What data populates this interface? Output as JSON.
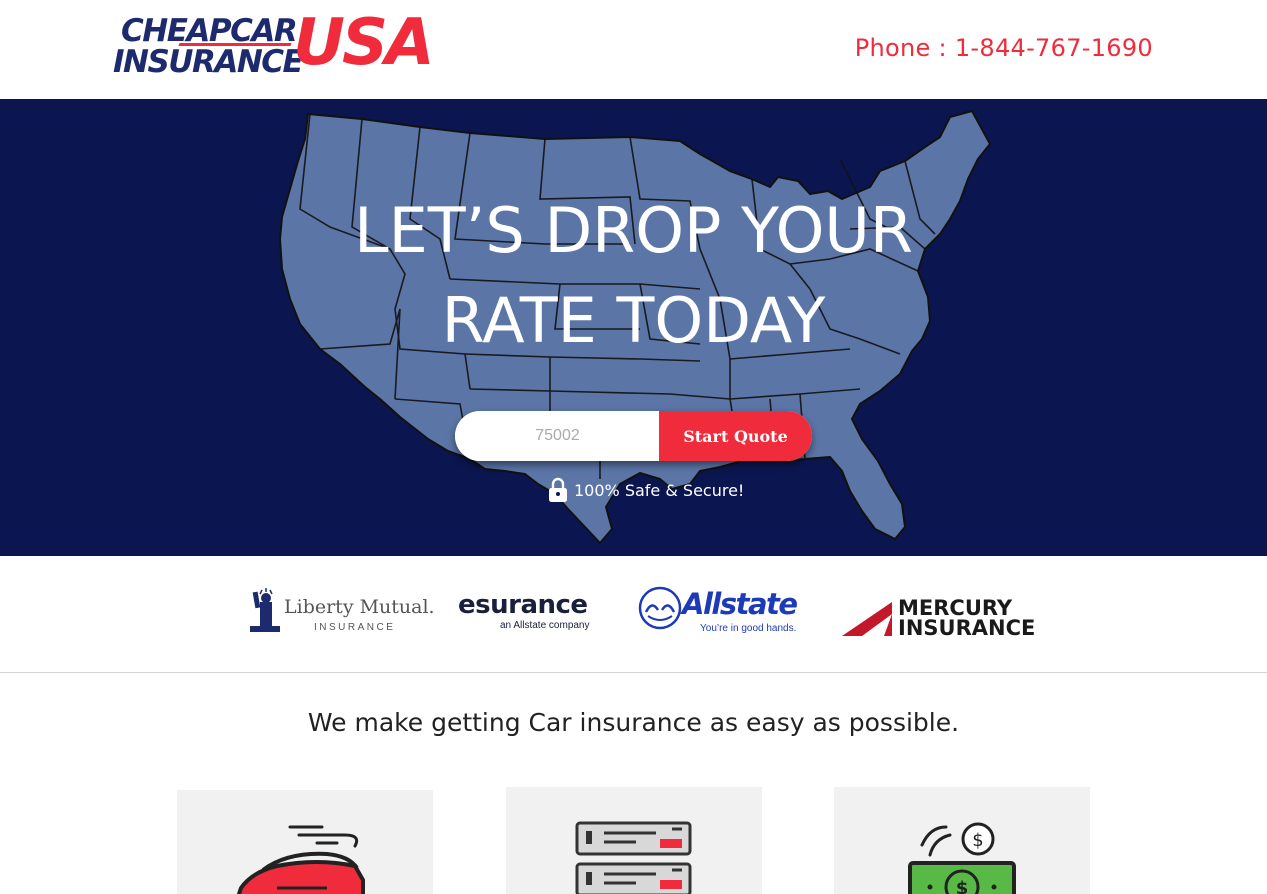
{
  "header": {
    "logo": {
      "line1": "CHEAPCAR",
      "line2": "INSURANCE",
      "accent": "USA"
    },
    "phone_text": "Phone : 1-844-767-1690"
  },
  "hero": {
    "headline_line1": "LET’S DROP YOUR",
    "headline_line2": "RATE TODAY",
    "zip_input_placeholder": "75002",
    "start_button_label": "Start Quote",
    "secure_text": "100% Safe & Secure!"
  },
  "partners": {
    "liberty": {
      "name": "Liberty Mutual.",
      "sub": "INSURANCE"
    },
    "esurance": {
      "name": "esurance",
      "sub": "an Allstate company"
    },
    "allstate": {
      "name": "Allstate",
      "sub": "You’re in good hands."
    },
    "mercury": {
      "line1": "MERCURY",
      "line2": "INSURANCE"
    }
  },
  "tagline": "We make getting Car insurance as easy as possible.",
  "features": [
    {
      "icon": "car-icon"
    },
    {
      "icon": "server-icon"
    },
    {
      "icon": "money-icon"
    }
  ],
  "colors": {
    "brand_red": "#ef2b3c",
    "brand_navy": "#1d2b6e",
    "hero_bg": "#0b1650",
    "map_fill": "#5b75a6"
  }
}
